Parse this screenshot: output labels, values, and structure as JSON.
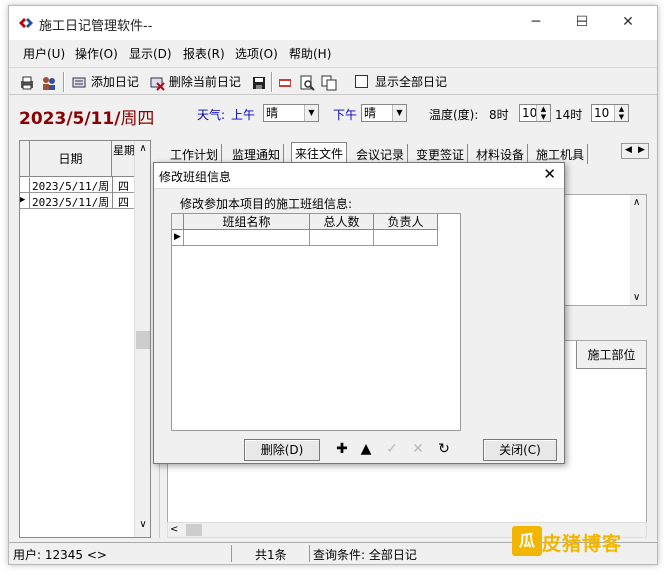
{
  "window": {
    "title": "施工日记管理软件--"
  },
  "window_controls": {
    "minimize": "─",
    "maximize": "☐",
    "close": "✕"
  },
  "menu": [
    "用户(U)",
    "操作(O)",
    "显示(D)",
    "报表(R)",
    "选项(O)",
    "帮助(H)"
  ],
  "toolbar": {
    "add_diary": "添加日记",
    "delete_diary": "删除当前日记",
    "show_all_label": "显示全部日记",
    "show_all_checked": false
  },
  "date_header": {
    "date": "2023/5/11/",
    "weekday": "周四"
  },
  "weather": {
    "label": "天气:",
    "am_label": "上午",
    "am_value": "晴",
    "pm_label": "下午",
    "pm_value": "晴",
    "temp_label": "温度(度):",
    "t1_label": "8时",
    "t1_value": "10",
    "t2_label": "14时",
    "t2_value": "10"
  },
  "left_grid": {
    "col_date": "日期",
    "col_week": "星期",
    "rows": [
      {
        "date": "2023/5/11/周",
        "week": "四"
      },
      {
        "date": "2023/5/11/周",
        "week": "四"
      }
    ]
  },
  "tabs": [
    "工作计划",
    "监理通知",
    "来往文件",
    "会议记录",
    "变更签证",
    "材料设备",
    "施工机具"
  ],
  "active_tab": "来往文件",
  "lower_grid": {
    "header": "施工部位"
  },
  "statusbar": {
    "user": "用户: 12345 <>",
    "count": "共1条",
    "query": "查询条件: 全部日记"
  },
  "dialog": {
    "title": "修改班组信息",
    "label": "修改参加本项目的施工班组信息:",
    "columns": [
      "班组名称",
      "总人数",
      "负责人"
    ],
    "delete_button": "删除(D)",
    "close_button": "关闭(C)",
    "nav_icons": [
      "add-icon",
      "prior-icon",
      "post-icon",
      "cancel-icon",
      "refresh-icon"
    ]
  },
  "watermark": {
    "text": "皮猪博客"
  },
  "colors": {
    "date_red": "#8b0000",
    "weather_blue": "#0000c0",
    "watermark": "#f2b600"
  }
}
